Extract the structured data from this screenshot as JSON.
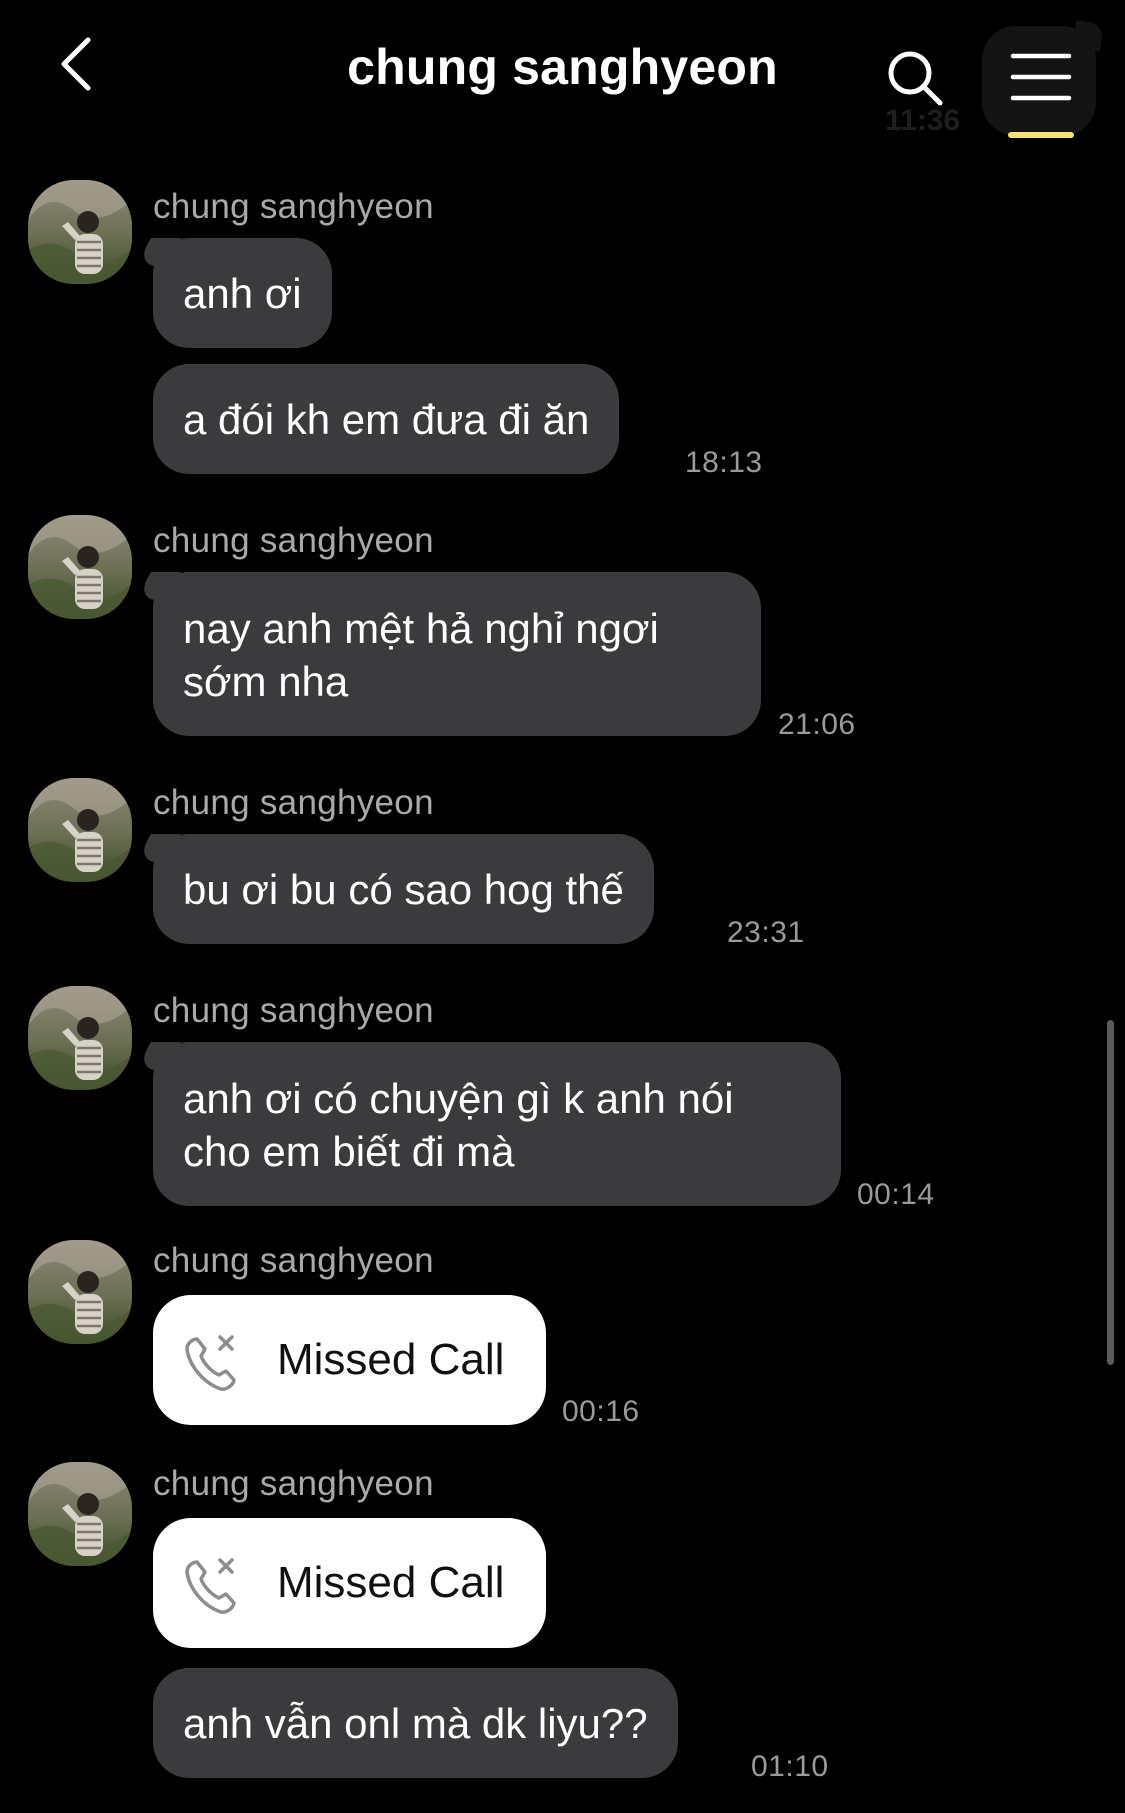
{
  "header": {
    "title": "chung sanghyeon",
    "ghost_time": "11:36"
  },
  "colors": {
    "background": "#000000",
    "bubble": "#3b3b3d",
    "call_bubble": "#ffffff",
    "sender_text": "#a9a9a9",
    "time_text": "#9a9a9a",
    "menu_accent": "#f7e27a"
  },
  "messages": [
    {
      "sender": "chung sanghyeon",
      "texts": [
        "anh ơi",
        "a đói kh em đưa đi ăn"
      ],
      "time": "18:13"
    },
    {
      "sender": "chung sanghyeon",
      "texts": [
        "nay anh mệt hả nghỉ ngơi sớm nha"
      ],
      "time": "21:06"
    },
    {
      "sender": "chung sanghyeon",
      "texts": [
        "bu ơi bu có sao hog thế"
      ],
      "time": "23:31"
    },
    {
      "sender": "chung sanghyeon",
      "texts": [
        "anh ơi có chuyện gì k anh nói cho em biết đi mà"
      ],
      "time": "00:14"
    },
    {
      "sender": "chung sanghyeon",
      "call_label": "Missed Call",
      "time": "00:16"
    },
    {
      "sender": "chung sanghyeon",
      "call_label": "Missed Call",
      "texts": [
        "anh vẫn onl mà dk liyu??"
      ],
      "time": "01:10"
    }
  ],
  "icons": {
    "back": "chevron-left-icon",
    "search": "search-icon",
    "menu": "hamburger-menu-icon",
    "missed_call": "missed-call-icon",
    "avatar": "profile-photo"
  }
}
